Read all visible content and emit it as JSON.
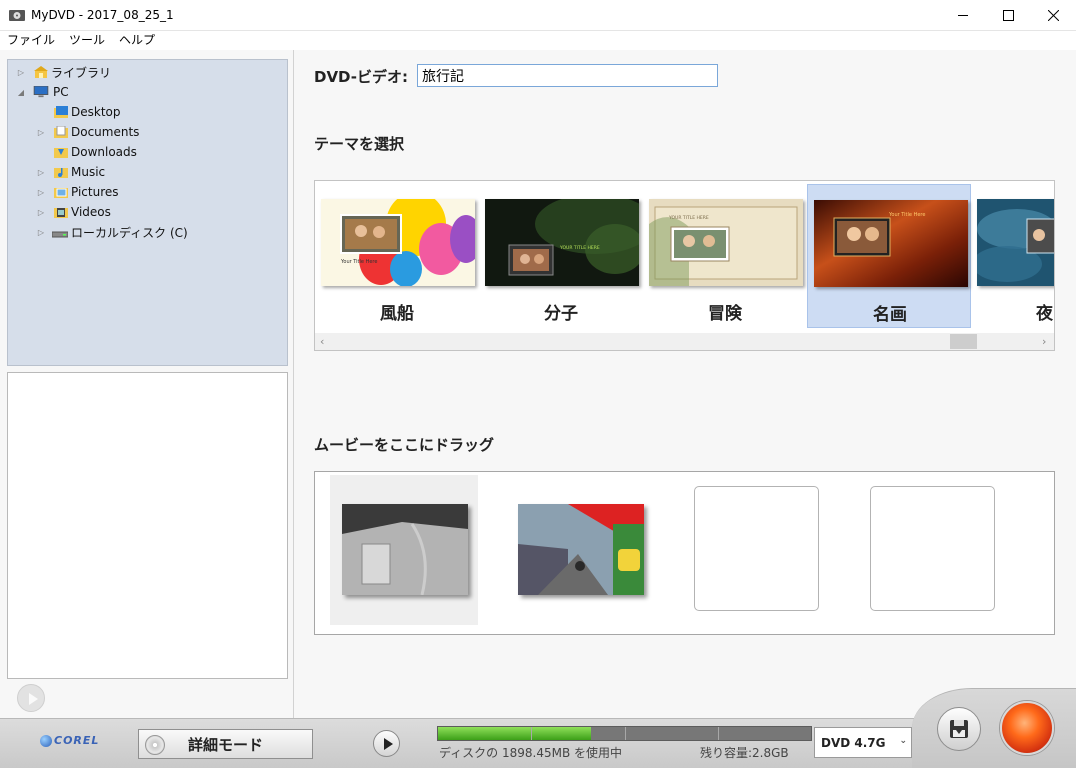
{
  "window": {
    "title": "MyDVD - 2017_08_25_1"
  },
  "menu": [
    "ファイル",
    "ツール",
    "ヘルプ"
  ],
  "tree": [
    {
      "label": "ライブラリ",
      "icon": "library-icon",
      "level": 0,
      "expandable": true,
      "expanded": false
    },
    {
      "label": "PC",
      "icon": "computer-icon",
      "level": 0,
      "expandable": true,
      "expanded": true
    },
    {
      "label": "Desktop",
      "icon": "folder-icon",
      "level": 1,
      "expandable": false
    },
    {
      "label": "Documents",
      "icon": "documents-folder-icon",
      "level": 1,
      "expandable": true
    },
    {
      "label": "Downloads",
      "icon": "downloads-folder-icon",
      "level": 1,
      "expandable": false
    },
    {
      "label": "Music",
      "icon": "music-folder-icon",
      "level": 1,
      "expandable": true
    },
    {
      "label": "Pictures",
      "icon": "pictures-folder-icon",
      "level": 1,
      "expandable": true
    },
    {
      "label": "Videos",
      "icon": "videos-folder-icon",
      "level": 1,
      "expandable": true
    },
    {
      "label": "ローカルディスク (C)",
      "icon": "drive-icon",
      "level": 1,
      "expandable": true
    }
  ],
  "dvd": {
    "label": "DVD-ビデオ:",
    "title_value": "旅行記"
  },
  "theme_section": {
    "title": "テーマを選択",
    "themes": [
      {
        "name": "風船",
        "thumb_caption": "Your Title Here",
        "selected": false
      },
      {
        "name": "分子",
        "thumb_caption": "YOUR TITLE HERE",
        "selected": false
      },
      {
        "name": "冒険",
        "thumb_caption": "YOUR TITLE HERE",
        "selected": false
      },
      {
        "name": "名画",
        "thumb_caption": "Your Title Here",
        "selected": true
      },
      {
        "name": "夜の",
        "thumb_caption": "",
        "selected": false
      }
    ]
  },
  "movie_section": {
    "title": "ムービーをここにドラッグ",
    "clips": [
      {
        "filled": true,
        "active": true
      },
      {
        "filled": true,
        "active": false
      },
      {
        "filled": false
      },
      {
        "filled": false
      }
    ]
  },
  "bottom": {
    "logo": "COREL",
    "detail_mode": "詳細モード",
    "capacity_used_text": "ディスクの 1898.45MB を使用中",
    "capacity_free_text": "残り容量:2.8GB",
    "capacity_fraction": 0.41,
    "disc_type": "DVD 4.7G"
  },
  "colors": {
    "tree_bg": "#d6deea",
    "selected_theme": "#cddcf3",
    "capacity_green": "#3ca018",
    "burn_orange": "#ff6a1a"
  }
}
